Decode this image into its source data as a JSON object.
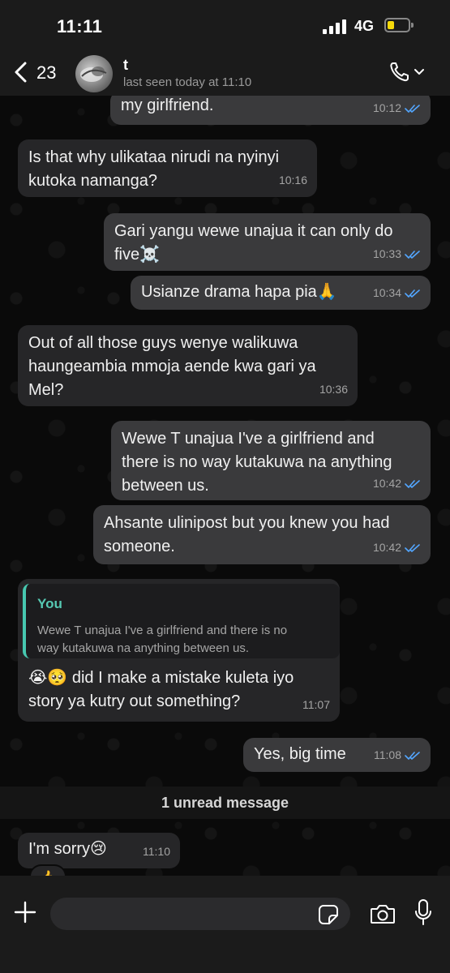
{
  "status_bar": {
    "time": "11:11",
    "network": "4G"
  },
  "header": {
    "back_count": "23",
    "contact_name": "t",
    "last_seen": "last seen today at 11:10",
    "icons": [
      "back-chevron-icon",
      "phone-icon",
      "chevron-down-icon"
    ]
  },
  "messages": [
    {
      "dir": "out",
      "text": "my girlfriend.",
      "time": "10:12",
      "read": true
    },
    {
      "dir": "in",
      "text": "Is that why ulikataa nirudi na nyinyi\nkutoka namanga?",
      "time": "10:16"
    },
    {
      "dir": "out",
      "text": "Gari yangu wewe unajua it can only do\nfive☠️",
      "time": "10:33",
      "read": true
    },
    {
      "dir": "out",
      "text": "Usianze drama hapa pia🙏",
      "time": "10:34",
      "read": true
    },
    {
      "dir": "in",
      "text": "Out of all those guys wenye walikuwa\nhaungeambia mmoja aende kwa gari ya\nMel?",
      "time": "10:36"
    },
    {
      "dir": "out",
      "text": "Wewe T unajua I've a girlfriend and\nthere is no way kutakuwa na anything\nbetween us.",
      "time": "10:42",
      "read": true
    },
    {
      "dir": "out",
      "text": "Ahsante ulinipost but you knew you had\nsomeone.",
      "time": "10:42",
      "read": true
    },
    {
      "dir": "in",
      "quote_name": "You",
      "quote_text": "Wewe T unajua I've a girlfriend and there is no\nway kutakuwa na anything between us.",
      "text": "😭🥺 did I make a mistake kuleta iyo\nstory ya kutry out something?",
      "time": "11:07"
    },
    {
      "dir": "out",
      "text": "Yes, big time",
      "time": "11:08",
      "read": true
    },
    {
      "dir": "in",
      "text": "I'm sorry😢",
      "time": "11:10",
      "reaction": "👍"
    }
  ],
  "unread_label": "1 unread message",
  "input_bar": {
    "placeholder": "",
    "icons": [
      "plus-icon",
      "sticker-icon",
      "camera-icon",
      "mic-icon"
    ]
  },
  "colors": {
    "header_bg": "#1b1b1b",
    "outgoing_bubble": "#3a3a3c",
    "incoming_bubble": "#262628",
    "read_ticks": "#53a6ff",
    "quote_accent": "#47c8b0",
    "battery": "#f5d90a"
  }
}
